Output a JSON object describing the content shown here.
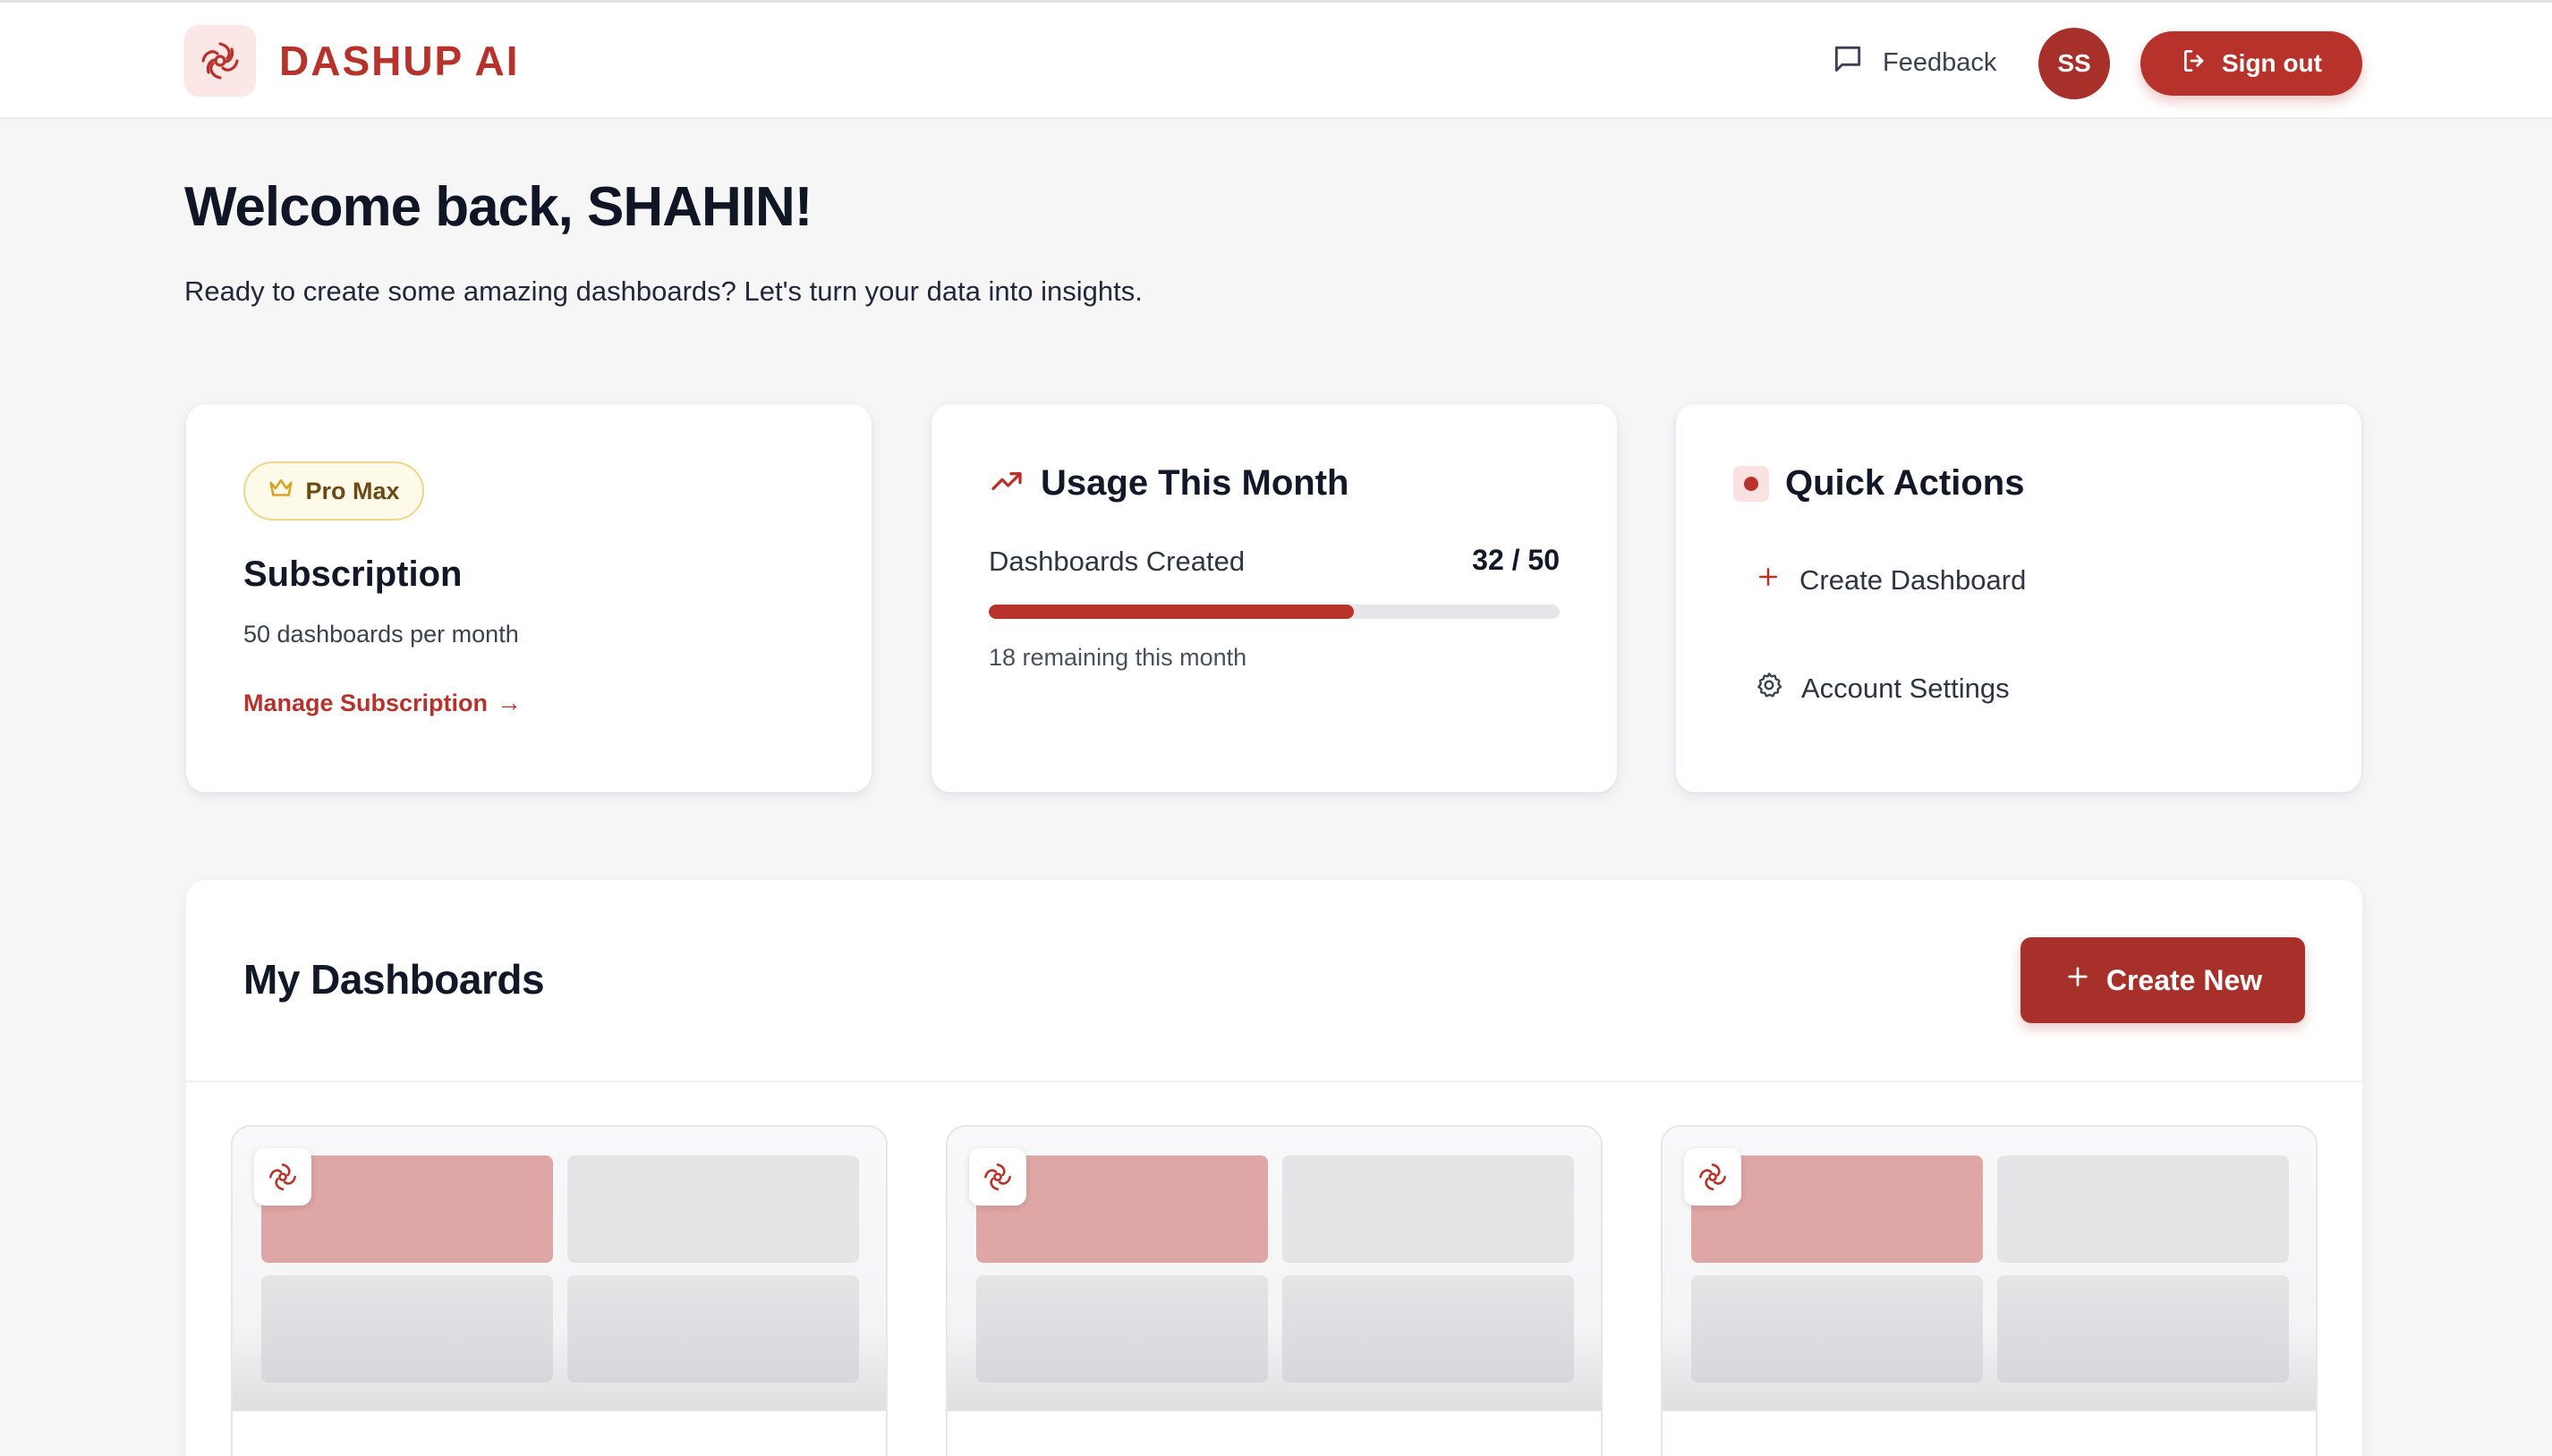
{
  "header": {
    "brand_name": "DASHUP AI",
    "logo_icon": "swirl-logo-icon",
    "feedback_label": "Feedback",
    "avatar_initials": "SS",
    "signout_label": "Sign out"
  },
  "welcome": {
    "title": "Welcome back, SHAHIN!",
    "subtitle": "Ready to create some amazing dashboards? Let's turn your data into insights."
  },
  "subscription_card": {
    "badge": "Pro Max",
    "title": "Subscription",
    "description": "50 dashboards per month",
    "link_label": "Manage Subscription",
    "link_arrow": "→"
  },
  "usage_card": {
    "title": "Usage This Month",
    "label": "Dashboards Created",
    "value_text": "32 / 50",
    "used": 32,
    "limit": 50,
    "remaining_text": "18 remaining this month"
  },
  "quick_actions": {
    "title": "Quick Actions",
    "items": [
      {
        "label": "Create Dashboard",
        "icon": "plus-icon"
      },
      {
        "label": "Account Settings",
        "icon": "gear-icon"
      }
    ]
  },
  "dashboards": {
    "title": "My Dashboards",
    "create_label": "Create New",
    "items": [
      {},
      {},
      {}
    ]
  },
  "colors": {
    "brand": "#b8322c",
    "brand_dark": "#a8302a",
    "background": "#f6f6f7"
  }
}
